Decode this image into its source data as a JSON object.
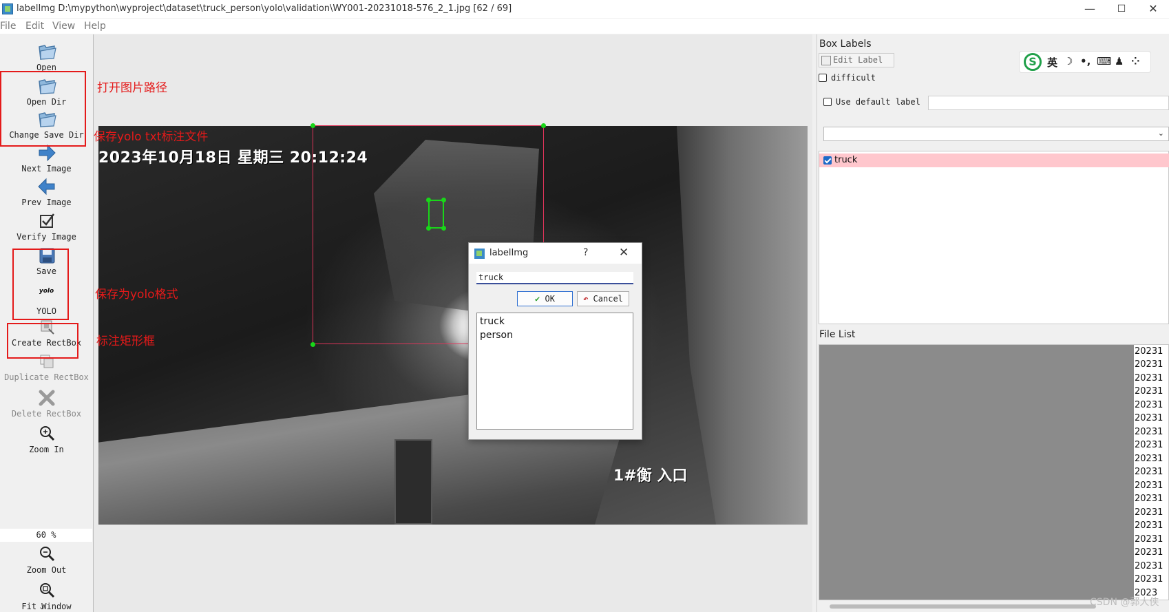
{
  "window": {
    "title": "labelImg D:\\mypython\\wyproject\\dataset\\truck_person\\yolo\\validation\\WY001-20231018-576_2_1.jpg [62 / 69]",
    "minimize": "—",
    "maximize": "☐",
    "close": "✕"
  },
  "menu": [
    "File",
    "Edit",
    "View",
    "Help"
  ],
  "toolbar": {
    "open": "Open",
    "open_dir": "Open Dir",
    "change_save_dir": "Change Save Dir",
    "next_image": "Next Image",
    "prev_image": "Prev Image",
    "verify_image": "Verify Image",
    "save": "Save",
    "format_icon_text": "yolo",
    "format": "YOLO",
    "create_rectbox": "Create RectBox",
    "duplicate_rectbox": "Duplicate RectBox",
    "delete_rectbox": "Delete RectBox",
    "zoom_in": "Zoom In",
    "zoom_value": "60 %",
    "zoom_out": "Zoom Out",
    "fit_window": "Fit Window",
    "more": "⌄"
  },
  "annotations": {
    "open_dir_note": "打开图片路径",
    "save_dir_note": "保存yolo txt标注文件",
    "format_note": "保存为yolo格式",
    "rectbox_note": "标注矩形框"
  },
  "image": {
    "osd_timestamp": "2023年10月18日 星期三 20:12:24",
    "osd_gate": "1#衡 入口"
  },
  "dialog": {
    "title": "labelImg",
    "help": "?",
    "close": "✕",
    "input_value": "truck",
    "ok_label": "OK",
    "cancel_label": "Cancel",
    "labels": [
      "truck",
      "person"
    ]
  },
  "right_panel": {
    "box_labels_title": "Box Labels",
    "edit_label": "Edit Label",
    "difficult": "difficult",
    "use_default_label": "Use default label",
    "labels": [
      {
        "name": "truck",
        "checked": true
      }
    ],
    "file_list_title": "File List",
    "file_rows": [
      "20231",
      "20231",
      "20231",
      "20231",
      "20231",
      "20231",
      "20231",
      "20231",
      "20231",
      "20231",
      "20231",
      "20231",
      "20231",
      "20231",
      "20231",
      "20231",
      "20231",
      "20231",
      "2023"
    ]
  },
  "ime": {
    "logo": "S",
    "lang": "英",
    "moon": "☽",
    "dots": "•,",
    "keyboard": "⌨",
    "user": "♟",
    "grid": "⁘"
  },
  "watermark": "CSDN @郭大侠",
  "colors": {
    "accent_red": "#e41a1a",
    "box_green": "#19d619",
    "label_selected_bg": "#ffc7cd",
    "checkbox_blue": "#1e6ac8"
  }
}
